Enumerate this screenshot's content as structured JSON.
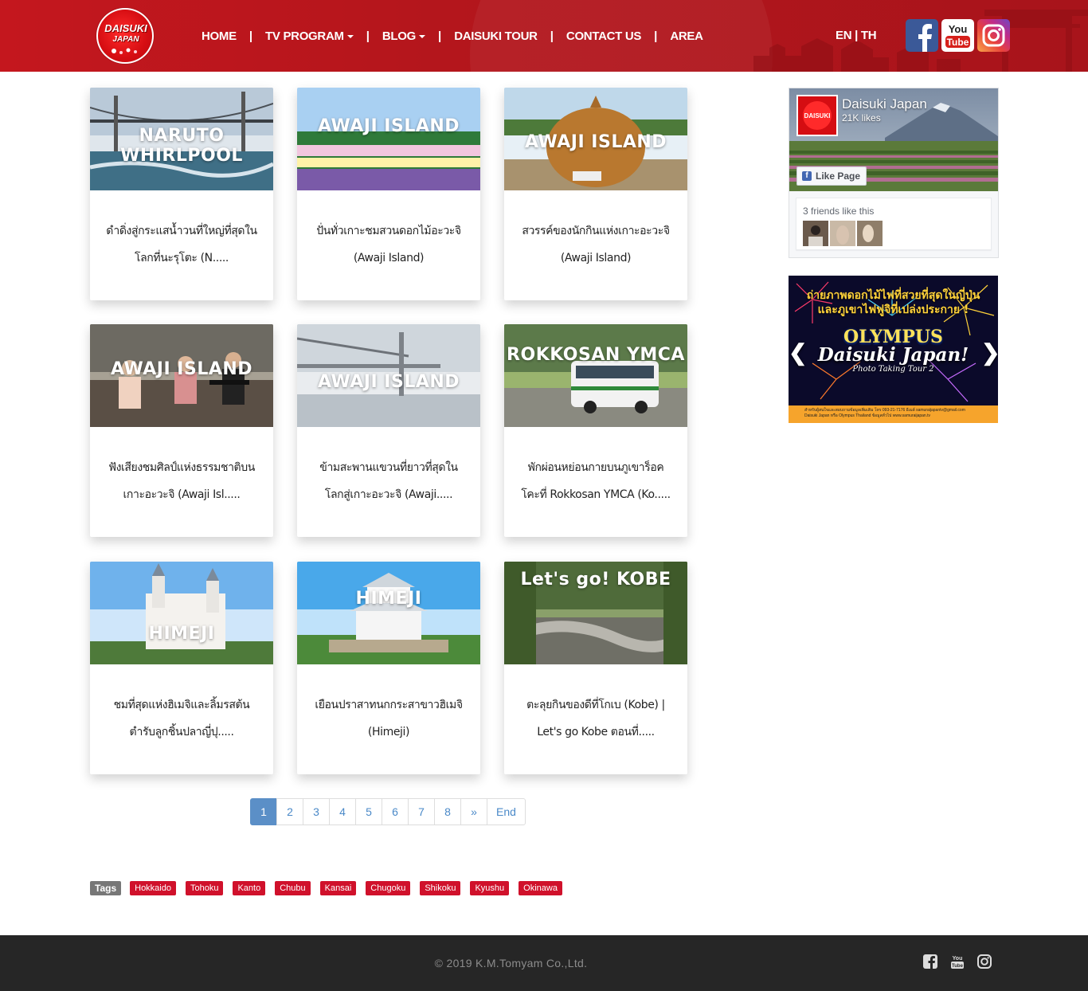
{
  "header": {
    "logo_line1": "DAISUKI",
    "logo_line2": "JAPAN",
    "nav": [
      {
        "label": "HOME",
        "dropdown": false
      },
      {
        "label": "TV PROGRAM",
        "dropdown": true
      },
      {
        "label": "BLOG",
        "dropdown": true
      },
      {
        "label": "DAISUKI TOUR",
        "dropdown": false
      },
      {
        "label": "CONTACT US",
        "dropdown": false
      },
      {
        "label": "AREA",
        "dropdown": false
      }
    ],
    "separator": "|",
    "lang": "EN | TH",
    "social": [
      {
        "name": "facebook-icon",
        "glyph": "f"
      },
      {
        "name": "youtube-icon",
        "line1": "You",
        "line2": "Tube"
      },
      {
        "name": "instagram-icon"
      }
    ]
  },
  "cards": [
    {
      "overlay": "NARUTO WHIRLPOOL",
      "title_line1": "ดำดิ่งสู่กระแสน้ำวนที่ใหญ่ที่สุดใน",
      "title_line2": "โลกที่นะรุโตะ (N....."
    },
    {
      "overlay": "AWAJI ISLAND",
      "title_line1": "ปั่นทั่วเกาะชมสวนดอกไม้อะวะจิ",
      "title_line2": "(Awaji Island)"
    },
    {
      "overlay": "AWAJI ISLAND",
      "title_line1": "สวรรค์ของนักกินแห่งเกาะอะวะจิ",
      "title_line2": "(Awaji Island)"
    },
    {
      "overlay": "AWAJI ISLAND",
      "title_line1": "ฟังเสียงชมศิลป์แห่งธรรมชาติบน",
      "title_line2": "เกาะอะวะจิ (Awaji Isl....."
    },
    {
      "overlay": "AWAJI ISLAND",
      "title_line1": "ข้ามสะพานแขวนที่ยาวที่สุดใน",
      "title_line2": "โลกสู่เกาะอะวะจิ (Awaji....."
    },
    {
      "overlay": "ROKKOSAN YMCA",
      "title_line1": "พักผ่อนหย่อนกายบนภูเขาร็อค",
      "title_line2": "โคะที่ Rokkosan YMCA (Ko....."
    },
    {
      "overlay": "HIMEJI",
      "title_line1": "ชมที่สุดแห่งฮิเมจิและลิ้มรสต้น",
      "title_line2": "ตำรับลูกชิ้นปลาญี่ปุ....."
    },
    {
      "overlay": "HIMEJI",
      "title_line1": "เยือนปราสาทนกกระสาขาวฮิเมจิ",
      "title_line2": "(Himeji)"
    },
    {
      "overlay": "Let's go! KOBE",
      "title_line1": "ตะลุยกินของดีที่โกเบ (Kobe) |",
      "title_line2": "Let's go Kobe ตอนที่....."
    }
  ],
  "pagination": {
    "pages": [
      "1",
      "2",
      "3",
      "4",
      "5",
      "6",
      "7",
      "8",
      "»",
      "End"
    ],
    "active": "1"
  },
  "tags": {
    "label": "Tags",
    "items": [
      "Hokkaido",
      "Tohoku",
      "Kanto",
      "Chubu",
      "Kansai",
      "Chugoku",
      "Shikoku",
      "Kyushu",
      "Okinawa"
    ]
  },
  "sidebar": {
    "fb_page_name": "Daisuki Japan",
    "fb_likes": "21K likes",
    "fb_like_button": "Like Page",
    "fb_friends_text": "3 friends like this",
    "banner": {
      "line1": "ถ่ายภาพดอกไม้ไฟที่สวยที่สุดในญี่ปุ่น",
      "line2": "และภูเขาไฟฟูจิที่เปล่งประกาย !",
      "brand": "OLYMPUS",
      "title": "Daisuki Japan!",
      "subtitle": "Photo Taking Tour 2",
      "footer1": "สำหรับผู้สนใจและสอบถามข้อมูลเพิ่มเติม โทร 093-21-7176 อีเมล์ samuraijapantv@gmail.com",
      "footer2": "Daisuki Japan หรือ Olympus Thailand ข้อมูลทั่วไป www.samuraijapan.tv"
    }
  },
  "footer": {
    "copyright": "© 2019 K.M.Tomyam Co.,Ltd."
  },
  "colors": {
    "header_red": "#b4161c",
    "tag_red": "#d0112b",
    "pager_blue": "#5b8fc7",
    "footer_bg": "#262626"
  }
}
